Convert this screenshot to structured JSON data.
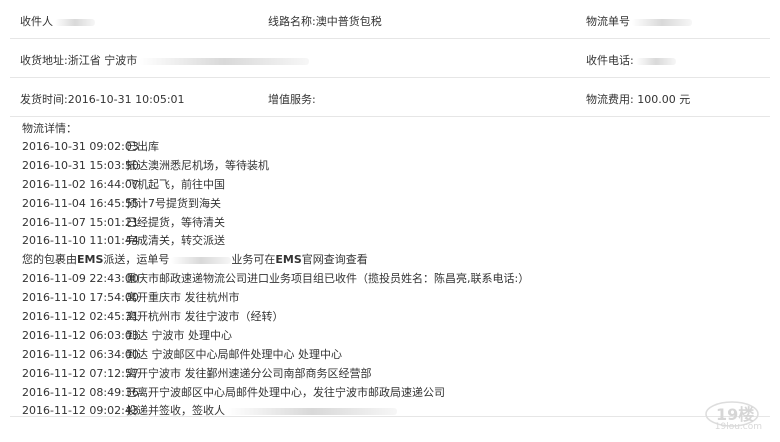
{
  "header": {
    "receiver_label": "收件人",
    "route_label": "线路名称:澳中普货包税",
    "tracking_label": "物流单号"
  },
  "address": {
    "address_label": "收货地址:浙江省 宁波市",
    "phone_label": "收件电话:"
  },
  "shipping": {
    "ship_time": "发货时间:2016-10-31 10:05:01",
    "value_added": "增值服务:",
    "fee": "物流费用: 100.00 元"
  },
  "details": {
    "title": "物流详情：",
    "entries": [
      {
        "time": "2016-10-31 09:02:03",
        "text": "已出库"
      },
      {
        "time": "2016-10-31 15:03:50",
        "text": "抵达澳洲悉尼机场，等待装机"
      },
      {
        "time": "2016-11-02 16:44:07",
        "text": "飞机起飞，前往中国"
      },
      {
        "time": "2016-11-04 16:45:55",
        "text": "预计7号提货到海关"
      },
      {
        "time": "2016-11-07 15:01:21",
        "text": "已经提货，等待清关"
      },
      {
        "time": "2016-11-10 11:01:44",
        "text": "完成清关，转交派送"
      }
    ],
    "ems_note_prefix": "您的包裹由",
    "ems_bold_1": "EMS",
    "ems_note_mid": "派送，运单号",
    "ems_note_tail": "业务可在",
    "ems_bold_2": "EMS",
    "ems_note_end": "官网查询查看",
    "ems_entries": [
      {
        "time": "2016-11-09 22:43:00",
        "text": "重庆市邮政速递物流公司进口业务项目组已收件（揽投员姓名：陈昌亮,联系电话:）"
      },
      {
        "time": "2016-11-10 17:54:00",
        "text": "离开重庆市 发往杭州市"
      },
      {
        "time": "2016-11-12 02:45:31",
        "text": "离开杭州市 发往宁波市（经转）"
      },
      {
        "time": "2016-11-12 06:03:03",
        "text": "到达 宁波市 处理中心"
      },
      {
        "time": "2016-11-12 06:34:00",
        "text": "到达 宁波邮区中心局邮件处理中心 处理中心"
      },
      {
        "time": "2016-11-12 07:12:57",
        "text": "离开宁波市 发往鄞州速递分公司南部商务区经营部"
      },
      {
        "time": "2016-11-12 08:49:36",
        "text": "已离开宁波邮区中心局邮件处理中心，发往宁波市邮政局速递公司"
      },
      {
        "time": "2016-11-12 09:02:43",
        "text": "投递并签收，签收人"
      }
    ]
  },
  "watermark": {
    "logo": "19楼",
    "site": "19lou.com"
  }
}
